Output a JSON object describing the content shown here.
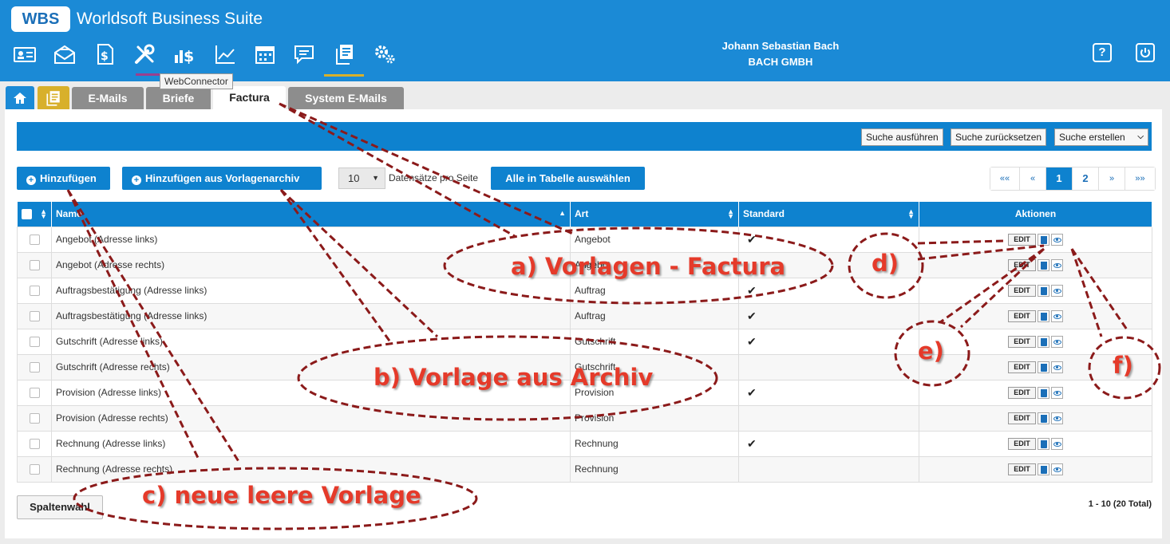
{
  "app": {
    "logo": "WBS",
    "title": "Worldsoft Business Suite",
    "tooltip": "WebConnector",
    "user_name": "Johann Sebastian Bach",
    "company": "BACH GMBH",
    "help_icon": "?",
    "nav_icons": [
      "contact-card-icon",
      "mail-icon",
      "invoice-icon",
      "tools-icon",
      "sales-icon",
      "chart-icon",
      "calendar-icon",
      "message-icon",
      "documents-icon",
      "settings-icon"
    ],
    "accent_color": "#1b8ad6"
  },
  "tabs": [
    "E-Mails",
    "Briefe",
    "Factura",
    "System E-Mails"
  ],
  "search": {
    "run": "Suche ausführen",
    "reset": "Suche zurücksetzen",
    "create": "Suche erstellen"
  },
  "toolbar": {
    "add": "Hinzufügen",
    "add_archive": "Hinzufügen aus Vorlagenarchiv",
    "per_page_value": "10",
    "per_page_label": "Datensätze pro Seite",
    "select_all": "Alle in Tabelle auswählen"
  },
  "pager": {
    "first": "««",
    "prev": "«",
    "pages": [
      "1",
      "2"
    ],
    "current": "1",
    "next": "»",
    "last": "»»"
  },
  "table": {
    "columns": [
      "Name",
      "Art",
      "Standard",
      "Aktionen"
    ],
    "edit_label": "EDIT",
    "check_mark": "✔",
    "rows": [
      {
        "name": "Angebot (Adresse links)",
        "art": "Angebot",
        "standard": true
      },
      {
        "name": "Angebot (Adresse rechts)",
        "art": "Angebot",
        "standard": false
      },
      {
        "name": "Auftragsbestätigung (Adresse links)",
        "art": "Auftrag",
        "standard": true
      },
      {
        "name": "Auftragsbestätigung (Adresse links)",
        "art": "Auftrag",
        "standard": true
      },
      {
        "name": "Gutschrift (Adresse links)",
        "art": "Gutschrift",
        "standard": true
      },
      {
        "name": "Gutschrift (Adresse rechts)",
        "art": "Gutschrift",
        "standard": false
      },
      {
        "name": "Provision (Adresse links)",
        "art": "Provision",
        "standard": true
      },
      {
        "name": "Provision (Adresse rechts)",
        "art": "Provision",
        "standard": false
      },
      {
        "name": "Rechnung (Adresse links)",
        "art": "Rechnung",
        "standard": true
      },
      {
        "name": "Rechnung (Adresse rechts)",
        "art": "Rechnung",
        "standard": false
      }
    ]
  },
  "footer": {
    "columns_button": "Spaltenwahl",
    "total": "1 - 10 (20 Total)"
  },
  "annotations": {
    "a": "a) Vorlagen - Factura",
    "b": "b) Vorlage aus Archiv",
    "c": "c) neue leere Vorlage",
    "d": "d)",
    "e": "e)",
    "f": "f)",
    "color": "#e53a2a"
  }
}
